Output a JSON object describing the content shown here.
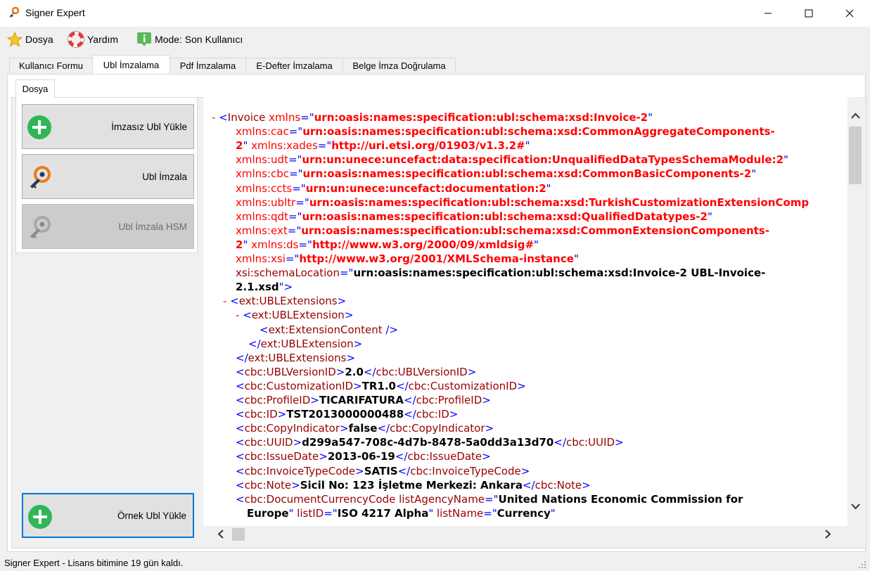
{
  "window": {
    "title": "Signer Expert",
    "minimize_icon": "minimize-icon",
    "maximize_icon": "maximize-icon",
    "close_icon": "close-icon"
  },
  "menu": {
    "items": [
      {
        "label": "Dosya",
        "icon": "star-icon"
      },
      {
        "label": "Yardım",
        "icon": "lifebuoy-icon"
      },
      {
        "label": "Mode: Son Kullanıcı",
        "icon": "info-icon"
      }
    ]
  },
  "tabs": [
    {
      "label": "Kullanıcı Formu",
      "active": false
    },
    {
      "label": "Ubl İmzalama",
      "active": true
    },
    {
      "label": "Pdf İmzalama",
      "active": false
    },
    {
      "label": "E-Defter İmzalama",
      "active": false
    },
    {
      "label": "Belge İmza Doğrulama",
      "active": false
    }
  ],
  "subtab": {
    "label": "Dosya"
  },
  "actions": [
    {
      "label": "İmzasız Ubl Yükle",
      "icon": "plus-circle-icon",
      "enabled": true
    },
    {
      "label": "Ubl İmzala",
      "icon": "key-icon",
      "enabled": true
    },
    {
      "label": "Ubl İmzala HSM",
      "icon": "key-icon",
      "enabled": false
    },
    {
      "label": "Örnek Ubl Yükle",
      "icon": "plus-circle-icon",
      "enabled": true
    }
  ],
  "xml_lines": [
    {
      "indent": 12,
      "segments": [
        [
          "m",
          "- "
        ],
        [
          "b",
          "<"
        ],
        [
          "t",
          "Invoice "
        ],
        [
          "an",
          "xmlns"
        ],
        [
          "b",
          "=\""
        ],
        [
          "av",
          "urn:oasis:names:specification:ubl:schema:xsd:Invoice-2"
        ],
        [
          "b",
          "\""
        ]
      ]
    },
    {
      "indent": 46,
      "segments": [
        [
          "an",
          "xmlns:cac"
        ],
        [
          "b",
          "=\""
        ],
        [
          "av",
          "urn:oasis:names:specification:ubl:schema:xsd:CommonAggregateComponents-"
        ]
      ]
    },
    {
      "indent": 46,
      "segments": [
        [
          "av",
          "2"
        ],
        [
          "b",
          "\" "
        ],
        [
          "an",
          "xmlns:xades"
        ],
        [
          "b",
          "=\""
        ],
        [
          "av",
          "http://uri.etsi.org/01903/v1.3.2#"
        ],
        [
          "b",
          "\""
        ]
      ]
    },
    {
      "indent": 46,
      "segments": [
        [
          "an",
          "xmlns:udt"
        ],
        [
          "b",
          "=\""
        ],
        [
          "av",
          "urn:un:unece:uncefact:data:specification:UnqualifiedDataTypesSchemaModule:2"
        ],
        [
          "b",
          "\""
        ]
      ]
    },
    {
      "indent": 46,
      "segments": [
        [
          "an",
          "xmlns:cbc"
        ],
        [
          "b",
          "=\""
        ],
        [
          "av",
          "urn:oasis:names:specification:ubl:schema:xsd:CommonBasicComponents-2"
        ],
        [
          "b",
          "\""
        ]
      ]
    },
    {
      "indent": 46,
      "segments": [
        [
          "an",
          "xmlns:ccts"
        ],
        [
          "b",
          "=\""
        ],
        [
          "av",
          "urn:un:unece:uncefact:documentation:2"
        ],
        [
          "b",
          "\""
        ]
      ]
    },
    {
      "indent": 46,
      "segments": [
        [
          "an",
          "xmlns:ubltr"
        ],
        [
          "b",
          "=\""
        ],
        [
          "av",
          "urn:oasis:names:specification:ubl:schema:xsd:TurkishCustomizationExtensionComp"
        ]
      ]
    },
    {
      "indent": 46,
      "segments": [
        [
          "an",
          "xmlns:qdt"
        ],
        [
          "b",
          "=\""
        ],
        [
          "av",
          "urn:oasis:names:specification:ubl:schema:xsd:QualifiedDatatypes-2"
        ],
        [
          "b",
          "\""
        ]
      ]
    },
    {
      "indent": 46,
      "segments": [
        [
          "an",
          "xmlns:ext"
        ],
        [
          "b",
          "=\""
        ],
        [
          "av",
          "urn:oasis:names:specification:ubl:schema:xsd:CommonExtensionComponents-"
        ]
      ]
    },
    {
      "indent": 46,
      "segments": [
        [
          "av",
          "2"
        ],
        [
          "b",
          "\" "
        ],
        [
          "an",
          "xmlns:ds"
        ],
        [
          "b",
          "=\""
        ],
        [
          "av",
          "http://www.w3.org/2000/09/xmldsig#"
        ],
        [
          "b",
          "\""
        ]
      ]
    },
    {
      "indent": 46,
      "segments": [
        [
          "an",
          "xmlns:xsi"
        ],
        [
          "b",
          "=\""
        ],
        [
          "av",
          "http://www.w3.org/2001/XMLSchema-instance"
        ],
        [
          "b",
          "\""
        ]
      ]
    },
    {
      "indent": 46,
      "segments": [
        [
          "t",
          "xsi:schemaLocation"
        ],
        [
          "b",
          "=\""
        ],
        [
          "x",
          "urn:oasis:names:specification:ubl:schema:xsd:Invoice-2 UBL-Invoice-"
        ]
      ]
    },
    {
      "indent": 46,
      "segments": [
        [
          "x",
          "2.1.xsd"
        ],
        [
          "b",
          "\">"
        ]
      ]
    },
    {
      "indent": 28,
      "segments": [
        [
          "m",
          "- "
        ],
        [
          "b",
          "<"
        ],
        [
          "t",
          "ext:UBLExtensions"
        ],
        [
          "b",
          ">"
        ]
      ]
    },
    {
      "indent": 46,
      "segments": [
        [
          "m",
          "- "
        ],
        [
          "b",
          "<"
        ],
        [
          "t",
          "ext:UBLExtension"
        ],
        [
          "b",
          ">"
        ]
      ]
    },
    {
      "indent": 80,
      "segments": [
        [
          "b",
          "<"
        ],
        [
          "t",
          "ext:ExtensionContent "
        ],
        [
          "b",
          "/>"
        ]
      ]
    },
    {
      "indent": 64,
      "segments": [
        [
          "b",
          "</"
        ],
        [
          "t",
          "ext:UBLExtension"
        ],
        [
          "b",
          ">"
        ]
      ]
    },
    {
      "indent": 46,
      "segments": [
        [
          "b",
          "</"
        ],
        [
          "t",
          "ext:UBLExtensions"
        ],
        [
          "b",
          ">"
        ]
      ]
    },
    {
      "indent": 46,
      "segments": [
        [
          "b",
          "<"
        ],
        [
          "t",
          "cbc:UBLVersionID"
        ],
        [
          "b",
          ">"
        ],
        [
          "x",
          "2.0"
        ],
        [
          "b",
          "</"
        ],
        [
          "t",
          "cbc:UBLVersionID"
        ],
        [
          "b",
          ">"
        ]
      ]
    },
    {
      "indent": 46,
      "segments": [
        [
          "b",
          "<"
        ],
        [
          "t",
          "cbc:CustomizationID"
        ],
        [
          "b",
          ">"
        ],
        [
          "x",
          "TR1.0"
        ],
        [
          "b",
          "</"
        ],
        [
          "t",
          "cbc:CustomizationID"
        ],
        [
          "b",
          ">"
        ]
      ]
    },
    {
      "indent": 46,
      "segments": [
        [
          "b",
          "<"
        ],
        [
          "t",
          "cbc:ProfileID"
        ],
        [
          "b",
          ">"
        ],
        [
          "x",
          "TICARIFATURA"
        ],
        [
          "b",
          "</"
        ],
        [
          "t",
          "cbc:ProfileID"
        ],
        [
          "b",
          ">"
        ]
      ]
    },
    {
      "indent": 46,
      "segments": [
        [
          "b",
          "<"
        ],
        [
          "t",
          "cbc:ID"
        ],
        [
          "b",
          ">"
        ],
        [
          "x",
          "TST2013000000488"
        ],
        [
          "b",
          "</"
        ],
        [
          "t",
          "cbc:ID"
        ],
        [
          "b",
          ">"
        ]
      ]
    },
    {
      "indent": 46,
      "segments": [
        [
          "b",
          "<"
        ],
        [
          "t",
          "cbc:CopyIndicator"
        ],
        [
          "b",
          ">"
        ],
        [
          "x",
          "false"
        ],
        [
          "b",
          "</"
        ],
        [
          "t",
          "cbc:CopyIndicator"
        ],
        [
          "b",
          ">"
        ]
      ]
    },
    {
      "indent": 46,
      "segments": [
        [
          "b",
          "<"
        ],
        [
          "t",
          "cbc:UUID"
        ],
        [
          "b",
          ">"
        ],
        [
          "x",
          "d299a547-708c-4d7b-8478-5a0dd3a13d70"
        ],
        [
          "b",
          "</"
        ],
        [
          "t",
          "cbc:UUID"
        ],
        [
          "b",
          ">"
        ]
      ]
    },
    {
      "indent": 46,
      "segments": [
        [
          "b",
          "<"
        ],
        [
          "t",
          "cbc:IssueDate"
        ],
        [
          "b",
          ">"
        ],
        [
          "x",
          "2013-06-19"
        ],
        [
          "b",
          "</"
        ],
        [
          "t",
          "cbc:IssueDate"
        ],
        [
          "b",
          ">"
        ]
      ]
    },
    {
      "indent": 46,
      "segments": [
        [
          "b",
          "<"
        ],
        [
          "t",
          "cbc:InvoiceTypeCode"
        ],
        [
          "b",
          ">"
        ],
        [
          "x",
          "SATIS"
        ],
        [
          "b",
          "</"
        ],
        [
          "t",
          "cbc:InvoiceTypeCode"
        ],
        [
          "b",
          ">"
        ]
      ]
    },
    {
      "indent": 46,
      "segments": [
        [
          "b",
          "<"
        ],
        [
          "t",
          "cbc:Note"
        ],
        [
          "b",
          ">"
        ],
        [
          "x",
          "Sicil No: 123 İşletme Merkezi: Ankara"
        ],
        [
          "b",
          "</"
        ],
        [
          "t",
          "cbc:Note"
        ],
        [
          "b",
          ">"
        ]
      ]
    },
    {
      "indent": 46,
      "segments": [
        [
          "b",
          "<"
        ],
        [
          "t",
          "cbc:DocumentCurrencyCode "
        ],
        [
          "t",
          "listAgencyName"
        ],
        [
          "b",
          "=\""
        ],
        [
          "x",
          "United Nations Economic Commission for"
        ]
      ]
    },
    {
      "indent": 62,
      "segments": [
        [
          "x",
          "Europe"
        ],
        [
          "b",
          "\" "
        ],
        [
          "t",
          "listID"
        ],
        [
          "b",
          "=\""
        ],
        [
          "x",
          "ISO 4217 Alpha"
        ],
        [
          "b",
          "\" "
        ],
        [
          "t",
          "listName"
        ],
        [
          "b",
          "=\""
        ],
        [
          "x",
          "Currency"
        ],
        [
          "b",
          "\""
        ]
      ]
    }
  ],
  "status": {
    "text": "Signer Expert - Lisans bitimine 19 gün kaldı."
  },
  "colors": {
    "focus": "#0078d7",
    "tag": "#990000",
    "markup": "#0000ff",
    "attr_value": "#ff0000"
  }
}
